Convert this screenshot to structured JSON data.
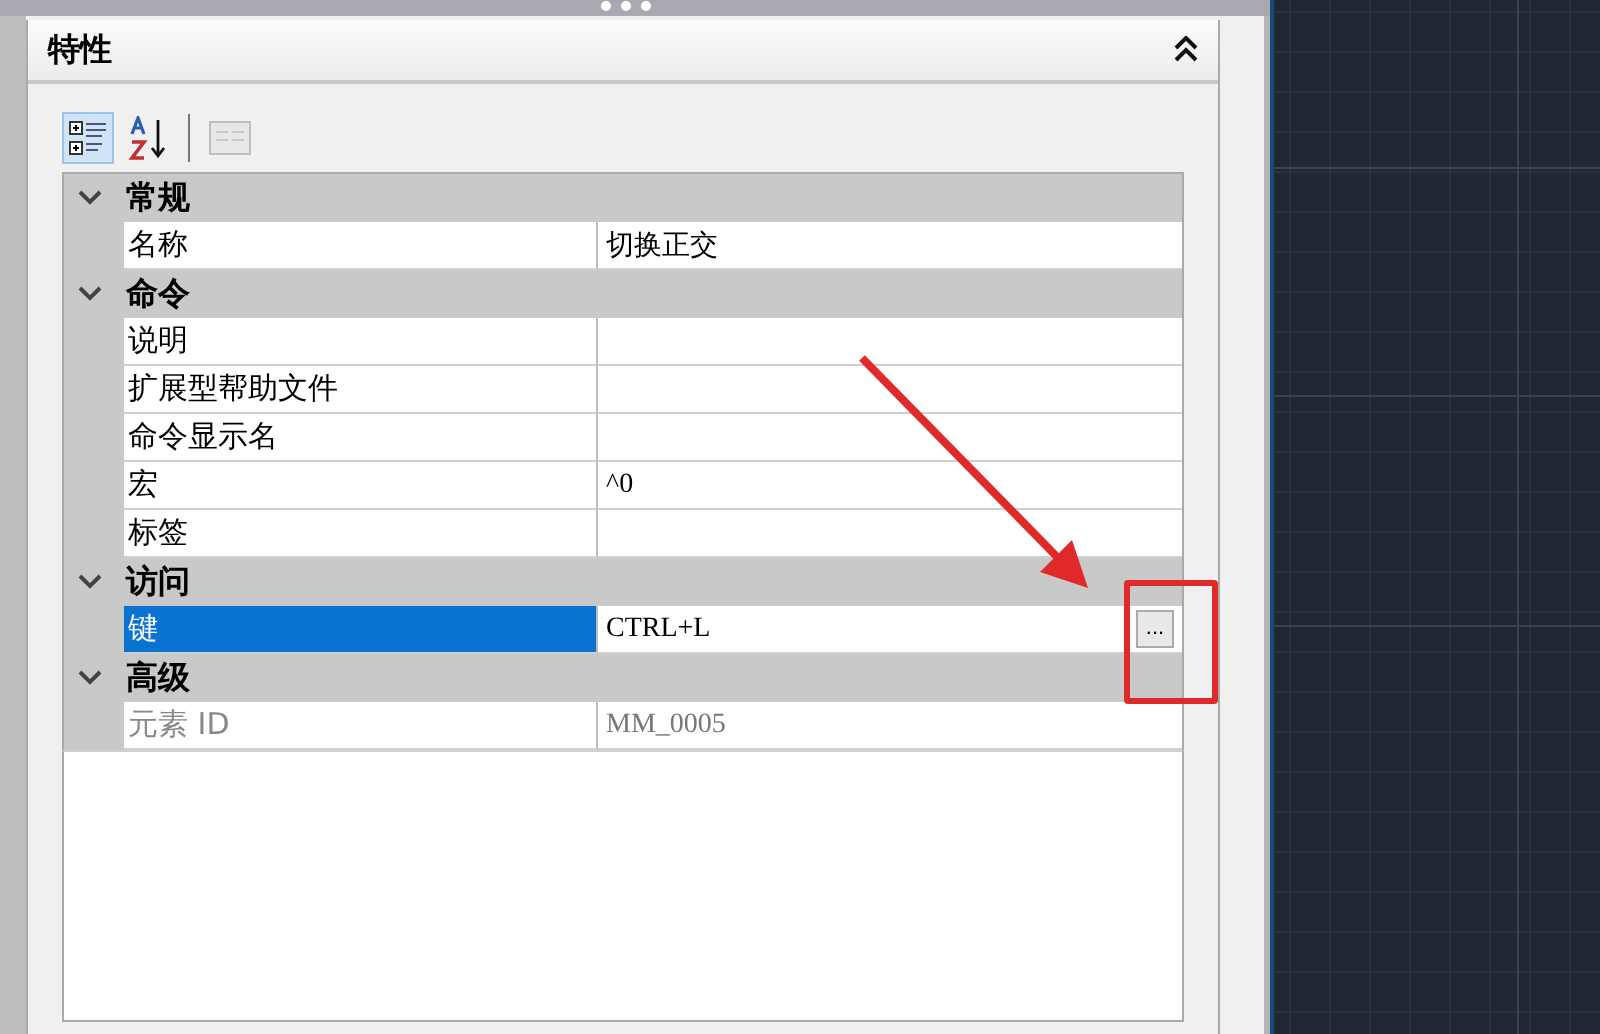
{
  "panel": {
    "title": "特性"
  },
  "toolbar": [
    {
      "kind": "categorized",
      "selected": true,
      "disabled": false
    },
    {
      "kind": "alphabetic",
      "selected": false,
      "disabled": false
    },
    {
      "kind": "pages",
      "selected": false,
      "disabled": true
    }
  ],
  "categories": [
    {
      "label": "常规",
      "expanded": true,
      "properties": [
        {
          "name": "名称",
          "value": "切换正交",
          "selected": false,
          "disabled": false
        }
      ]
    },
    {
      "label": "命令",
      "expanded": true,
      "properties": [
        {
          "name": "说明",
          "selected": false,
          "disabled": false
        },
        {
          "name": "扩展型帮助文件",
          "selected": false,
          "disabled": false
        },
        {
          "name": "命令显示名",
          "selected": false,
          "disabled": false
        },
        {
          "name": "宏",
          "value": "^0",
          "selected": false,
          "disabled": false
        },
        {
          "name": "标签",
          "selected": false,
          "disabled": false
        }
      ]
    },
    {
      "label": "访问",
      "expanded": true,
      "properties": [
        {
          "name": "键",
          "value": "CTRL+L",
          "button": "...",
          "selected": true,
          "disabled": false
        }
      ]
    },
    {
      "label": "高级",
      "expanded": true,
      "properties": [
        {
          "name": "元素 ID",
          "value": "MM_0005",
          "selected": false,
          "disabled": true
        }
      ]
    }
  ]
}
